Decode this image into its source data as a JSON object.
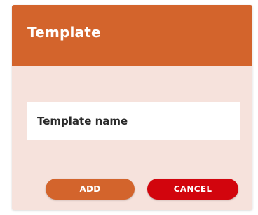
{
  "dialog": {
    "title": "Template",
    "name_field": {
      "value": "",
      "placeholder": "Template name"
    },
    "add_label": "ADD",
    "cancel_label": "CANCEL"
  },
  "colors": {
    "header": "#d3642c",
    "body": "#f6e2dc",
    "add_button": "#d3642c",
    "cancel_button": "#d2050d"
  }
}
